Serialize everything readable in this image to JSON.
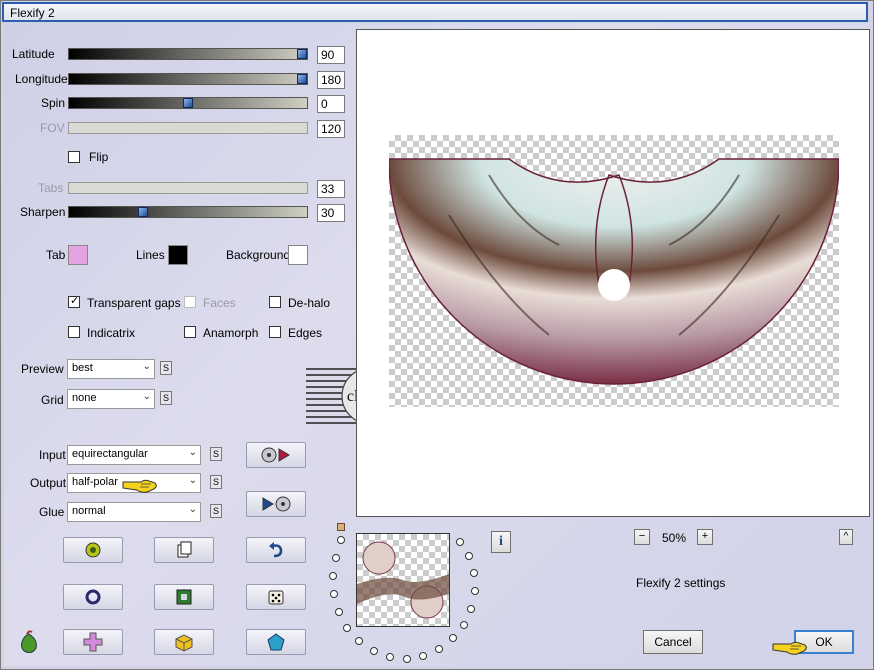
{
  "window": {
    "title": "Flexify 2"
  },
  "sliders": [
    {
      "label": "Latitude",
      "value": "90",
      "level": 1.0,
      "enabled": true
    },
    {
      "label": "Longitude",
      "value": "180",
      "level": 1.0,
      "enabled": true
    },
    {
      "label": "Spin",
      "value": "0",
      "level": 0.5,
      "enabled": true
    },
    {
      "label": "FOV",
      "value": "120",
      "enabled": false
    }
  ],
  "flip": {
    "label": "Flip",
    "checked": false
  },
  "tabs_slider": {
    "label": "Tabs",
    "value": "33",
    "enabled": false
  },
  "sharpen": {
    "label": "Sharpen",
    "value": "30",
    "level": 0.3,
    "enabled": true
  },
  "colors": {
    "tab": {
      "label": "Tab",
      "color": "#e3a3e2"
    },
    "lines": {
      "label": "Lines",
      "color": "#000000"
    },
    "background": {
      "label": "Background",
      "color": "#ffffff"
    }
  },
  "options": {
    "transparent_gaps": {
      "label": "Transparent gaps",
      "checked": true
    },
    "faces": {
      "label": "Faces",
      "checked": false,
      "enabled": false
    },
    "de_halo": {
      "label": "De-halo",
      "checked": false
    },
    "indicatrix": {
      "label": "Indicatrix",
      "checked": false
    },
    "anamorph": {
      "label": "Anamorph",
      "checked": false
    },
    "edges": {
      "label": "Edges",
      "checked": false
    }
  },
  "preview_select": {
    "label": "Preview",
    "value": "best"
  },
  "grid_select": {
    "label": "Grid",
    "value": "none"
  },
  "input_select": {
    "label": "Input",
    "value": "equirectangular"
  },
  "output_select": {
    "label": "Output",
    "value": "half-polar"
  },
  "glue_select": {
    "label": "Glue",
    "value": "normal"
  },
  "s_button_label": "S",
  "zoom": {
    "value": "50%",
    "minus": "−",
    "plus": "+"
  },
  "info_label": "i",
  "collapse_label": "^",
  "settings_caption": "Flexify 2 settings",
  "buttons": {
    "cancel": "Cancel",
    "ok": "OK"
  },
  "watermark_text": "claudia",
  "accent": "#3b7fd0"
}
